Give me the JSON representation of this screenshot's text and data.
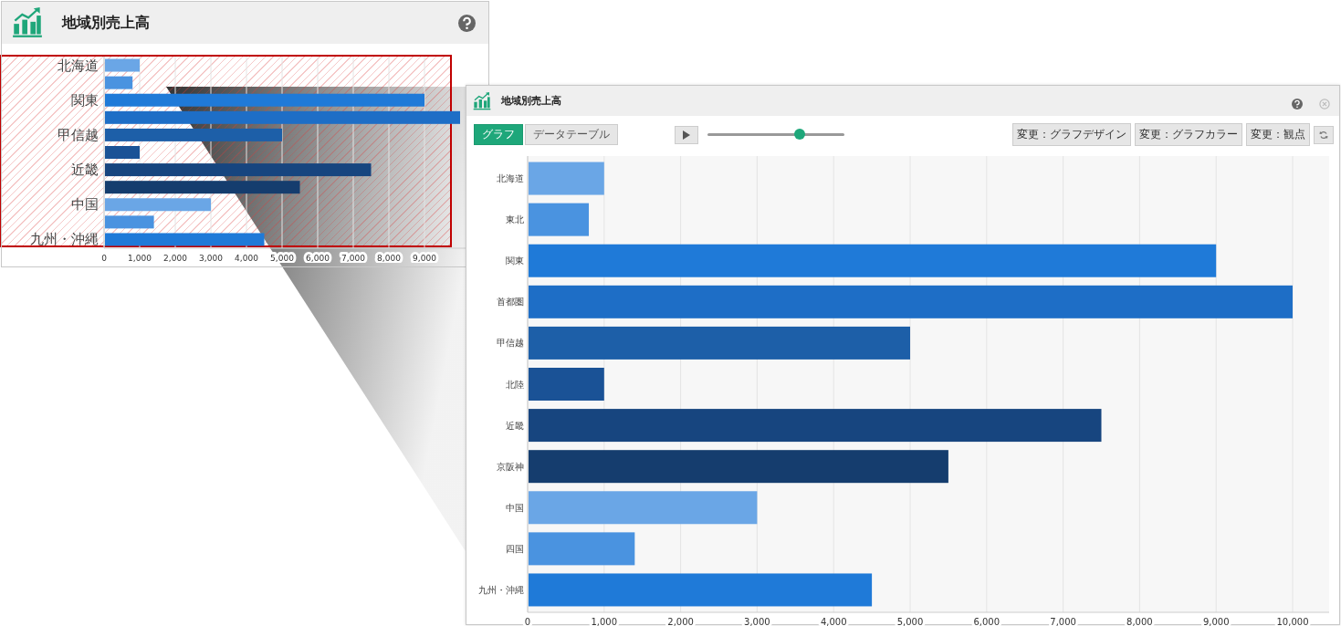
{
  "small_widget": {
    "title": "地域別売上高",
    "chart_data": {
      "type": "bar",
      "orientation": "horizontal",
      "categories": [
        "北海道",
        null,
        "関東",
        null,
        "甲信越",
        null,
        "近畿",
        null,
        "中国",
        null,
        "九州・沖縄"
      ],
      "values": [
        1000,
        800,
        9000,
        10000,
        5000,
        1000,
        7500,
        5500,
        3000,
        1400,
        4500
      ],
      "colors": [
        "#6aa6e6",
        "#4a93e0",
        "#1f7ad8",
        "#1e6ec6",
        "#1d5fa8",
        "#1a5296",
        "#17457f",
        "#153d6e",
        "#6aa6e6",
        "#4a93e0",
        "#1f7ad8"
      ],
      "xlim": [
        0,
        10000
      ],
      "xticks": [
        {
          "value": 0,
          "label": "0"
        },
        {
          "value": 1000,
          "label": "1,000"
        },
        {
          "value": 2000,
          "label": "2,000"
        },
        {
          "value": 3000,
          "label": "3,000"
        },
        {
          "value": 4000,
          "label": "4,000"
        },
        {
          "value": 5000,
          "label": "5,000"
        },
        {
          "value": 6000,
          "label": "6,000"
        },
        {
          "value": 7000,
          "label": "7,000"
        },
        {
          "value": 8000,
          "label": "8,000"
        },
        {
          "value": 9000,
          "label": "9,000"
        }
      ],
      "grid": true
    }
  },
  "large_widget": {
    "title": "地域別売上高",
    "tabs": [
      {
        "label": "グラフ",
        "selected": true
      },
      {
        "label": "データテーブル",
        "selected": false
      }
    ],
    "slider": {
      "level": 0.67
    },
    "buttons": [
      "変更：グラフデザイン",
      "変更：グラフカラー",
      "変更：観点"
    ],
    "chart_data": {
      "type": "bar",
      "orientation": "horizontal",
      "categories": [
        "北海道",
        "東北",
        "関東",
        "首都圏",
        "甲信越",
        "北陸",
        "近畿",
        "京阪神",
        "中国",
        "四国",
        "九州・沖縄"
      ],
      "values": [
        1000,
        800,
        9000,
        10000,
        5000,
        1000,
        7500,
        5500,
        3000,
        1400,
        4500
      ],
      "colors": [
        "#6aa6e6",
        "#4a93e0",
        "#1f7ad8",
        "#1e6ec6",
        "#1d5fa8",
        "#1a5296",
        "#17457f",
        "#153d6e",
        "#6aa6e6",
        "#4a93e0",
        "#1f7ad8"
      ],
      "xlim": [
        0,
        10000
      ],
      "xticks": [
        {
          "value": 0,
          "label": "0"
        },
        {
          "value": 1000,
          "label": "1,000"
        },
        {
          "value": 2000,
          "label": "2,000"
        },
        {
          "value": 3000,
          "label": "3,000"
        },
        {
          "value": 4000,
          "label": "4,000"
        },
        {
          "value": 5000,
          "label": "5,000"
        },
        {
          "value": 6000,
          "label": "6,000"
        },
        {
          "value": 7000,
          "label": "7,000"
        },
        {
          "value": 8000,
          "label": "8,000"
        },
        {
          "value": 9000,
          "label": "9,000"
        },
        {
          "value": 10000,
          "label": "10,000"
        }
      ],
      "grid": true
    }
  }
}
